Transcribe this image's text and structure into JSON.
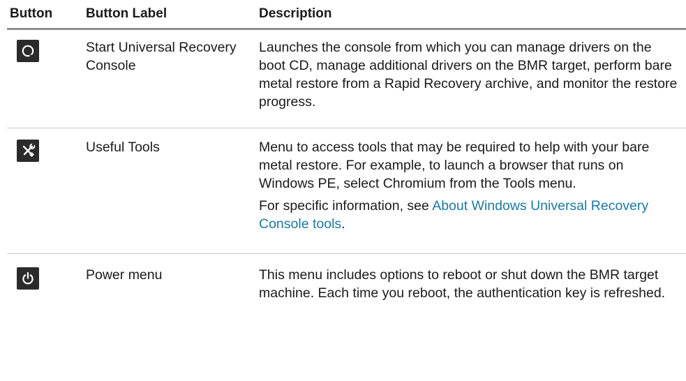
{
  "headers": {
    "button": "Button",
    "button_label": "Button Label",
    "description": "Description"
  },
  "rows": [
    {
      "icon": "console-ring-icon",
      "label": "Start Universal Recovery Console",
      "description": "Launches the console from which you can manage drivers on the boot CD, manage additional drivers on the BMR target, perform bare metal restore from a Rapid Recovery archive, and monitor the restore progress."
    },
    {
      "icon": "tools-wrench-screwdriver-icon",
      "label": "Useful Tools",
      "description": "Menu to access tools that may be required to help with your bare metal restore. For example, to launch a browser that runs on Windows PE, select Chromium from the Tools menu.",
      "extra_prefix": "For specific information, see ",
      "extra_link": "About Windows Universal Recovery Console tools",
      "extra_suffix": "."
    },
    {
      "icon": "power-icon",
      "label": "Power menu",
      "description": "This menu includes options to reboot or shut down the BMR target machine. Each time you reboot, the authentication key is refreshed."
    }
  ],
  "colors": {
    "icon_bg": "#2b2b2b",
    "link": "#1a7aa8",
    "header_rule": "#8f8f8f",
    "row_rule": "#c8c8c8"
  }
}
